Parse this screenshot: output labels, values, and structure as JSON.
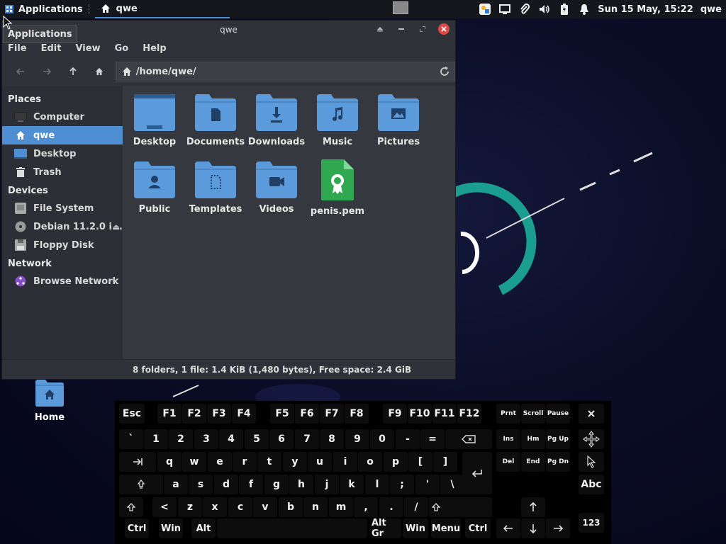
{
  "panel": {
    "apps_label": "Applications",
    "task_label": "qwe",
    "clock": "Sun 15 May, 15:22",
    "user": "qwe"
  },
  "tooltip": "Applications",
  "window": {
    "title": "qwe",
    "menu": [
      "File",
      "Edit",
      "View",
      "Go",
      "Help"
    ],
    "location": "/home/qwe/",
    "status": "8 folders, 1 file: 1.4 KiB (1,480 bytes), Free space: 2.4 GiB"
  },
  "sidebar": {
    "places_header": "Places",
    "places": [
      "Computer",
      "qwe",
      "Desktop",
      "Trash"
    ],
    "devices_header": "Devices",
    "devices": [
      "File System",
      "Debian 11.2.0 i...",
      "Floppy Disk"
    ],
    "network_header": "Network",
    "network": [
      "Browse Network"
    ]
  },
  "files": [
    "Desktop",
    "Documents",
    "Downloads",
    "Music",
    "Pictures",
    "Public",
    "Templates",
    "Videos",
    "penis.pem"
  ],
  "desktop_icon": "Home",
  "keyboard": {
    "row_fn": [
      "Esc",
      "F1",
      "F2",
      "F3",
      "F4",
      "F5",
      "F6",
      "F7",
      "F8",
      "F9",
      "F10",
      "F11",
      "F12",
      "Prnt",
      "Scroll",
      "Pause"
    ],
    "row_num": [
      "`",
      "1",
      "2",
      "3",
      "4",
      "5",
      "6",
      "7",
      "8",
      "9",
      "0",
      "-",
      "="
    ],
    "row_q": [
      "q",
      "w",
      "e",
      "r",
      "t",
      "y",
      "u",
      "i",
      "o",
      "p",
      "[",
      "]"
    ],
    "row_a": [
      "a",
      "s",
      "d",
      "f",
      "g",
      "h",
      "j",
      "k",
      "l",
      ";",
      "'",
      "\\"
    ],
    "row_z": [
      "<",
      "z",
      "x",
      "c",
      "v",
      "b",
      "n",
      "m",
      ",",
      ".",
      "/"
    ],
    "row_bottom_left": [
      "Ctrl",
      "Win",
      "Alt"
    ],
    "row_bottom_right": [
      "Alt Gr",
      "Win",
      "Menu",
      "Ctrl"
    ],
    "nav1": [
      "Ins",
      "Hm",
      "Pg Up"
    ],
    "nav2": [
      "Del",
      "End",
      "Pg Dn"
    ],
    "abc": "Abc",
    "num": "123"
  },
  "colors": {
    "accent": "#4e8fd4",
    "folder": "#5b9bdc",
    "pem": "#2fa84f",
    "close": "#e04848"
  }
}
